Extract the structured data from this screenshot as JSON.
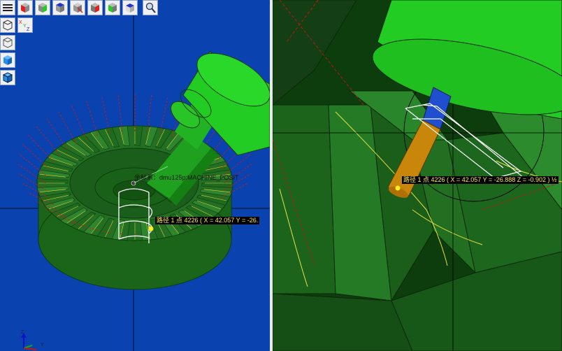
{
  "left_view": {
    "toolbar": [
      {
        "id": "menu",
        "icon": "hamburger-menu-icon"
      },
      {
        "id": "view-iso",
        "icon": "cube-red-face-icon"
      },
      {
        "id": "view-front",
        "icon": "cube-green-face-icon"
      },
      {
        "id": "view-top",
        "icon": "cube-blue-face-icon"
      },
      {
        "id": "view-side",
        "icon": "cube-axis-icon"
      },
      {
        "id": "view-right",
        "icon": "cube-red-right-icon"
      },
      {
        "id": "view-left",
        "icon": "cube-green-left-icon"
      },
      {
        "id": "view-bottom",
        "icon": "cube-top-blue-icon"
      },
      {
        "id": "zoom",
        "icon": "zoom-magnifier-icon"
      }
    ],
    "side_tools": [
      {
        "id": "wireframe",
        "icon": "wireframe-cube-icon"
      },
      {
        "id": "axes",
        "icon": "xyz-axes-icon",
        "axis_labels": [
          "X",
          "Y",
          "Z"
        ]
      },
      {
        "id": "hidden-line",
        "icon": "hidden-line-cube-icon"
      },
      {
        "id": "shaded",
        "icon": "shaded-cube-icon"
      },
      {
        "id": "shaded-edges",
        "icon": "shaded-edges-cube-icon"
      }
    ],
    "machine_label": "坐标系：dmu125p:MACHINE_POSIT",
    "point_label": "路径 1 点 4226 ( X = 42.057  Y = -26.",
    "triad": {
      "z": "Z",
      "x": "X",
      "y": "Y"
    }
  },
  "right_view": {
    "point_label": "路径 1 点 4226 ( X = 42.057  Y = -26.888  Z = -0.902 ) ½"
  },
  "colors": {
    "viewport_blue": "#0a42b0",
    "part_green": "#1c6b1c",
    "tool_green": "#22cc22",
    "holder_blue": "#1f4fcf",
    "cutter_orange": "#c8870a",
    "toolpath_white": "#ffffff",
    "toolpath_red": "#d01818",
    "toolpath_yellow": "#e8e040",
    "marker_yellow": "#ffee22"
  }
}
